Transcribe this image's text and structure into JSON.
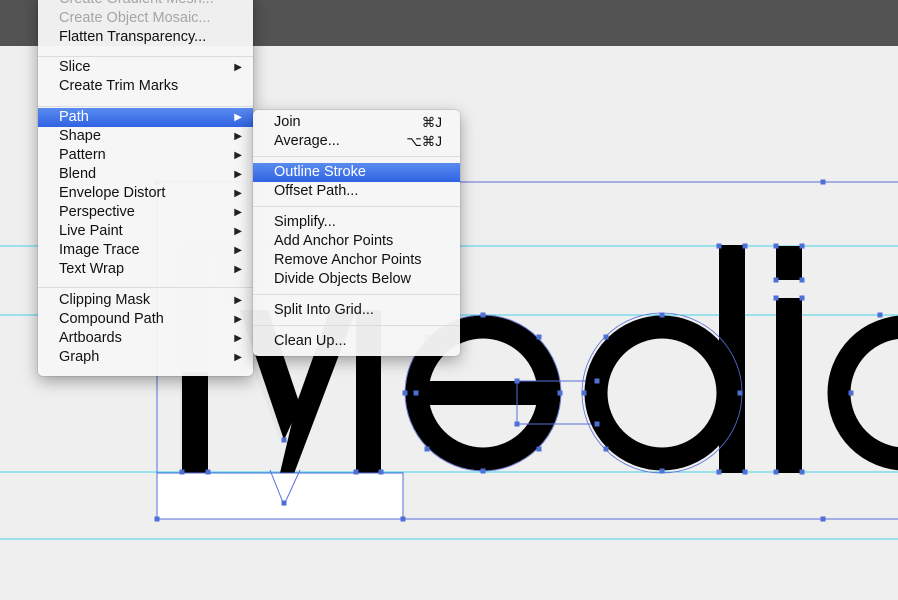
{
  "main_menu": {
    "items": [
      {
        "label": "Create Gradient Mesh...",
        "disabled": true,
        "submenu": false
      },
      {
        "label": "Create Object Mosaic...",
        "disabled": true,
        "submenu": false
      },
      {
        "label": "Flatten Transparency...",
        "disabled": false,
        "submenu": false
      },
      {
        "label": "Slice",
        "disabled": false,
        "submenu": true
      },
      {
        "label": "Create Trim Marks",
        "disabled": false,
        "submenu": false
      },
      {
        "label": "Path",
        "disabled": false,
        "submenu": true,
        "highlighted": true
      },
      {
        "label": "Shape",
        "disabled": false,
        "submenu": true
      },
      {
        "label": "Pattern",
        "disabled": false,
        "submenu": true
      },
      {
        "label": "Blend",
        "disabled": false,
        "submenu": true
      },
      {
        "label": "Envelope Distort",
        "disabled": false,
        "submenu": true
      },
      {
        "label": "Perspective",
        "disabled": false,
        "submenu": true
      },
      {
        "label": "Live Paint",
        "disabled": false,
        "submenu": true
      },
      {
        "label": "Image Trace",
        "disabled": false,
        "submenu": true
      },
      {
        "label": "Text Wrap",
        "disabled": false,
        "submenu": true
      },
      {
        "label": "Clipping Mask",
        "disabled": false,
        "submenu": true
      },
      {
        "label": "Compound Path",
        "disabled": false,
        "submenu": true
      },
      {
        "label": "Artboards",
        "disabled": false,
        "submenu": true
      },
      {
        "label": "Graph",
        "disabled": false,
        "submenu": true
      }
    ],
    "submenu_arrow": "▶"
  },
  "path_submenu": {
    "items": [
      {
        "label": "Join",
        "shortcut": "⌘J"
      },
      {
        "label": "Average...",
        "shortcut": "⌥⌘J"
      },
      {
        "label": "Outline Stroke",
        "shortcut": "",
        "highlighted": true
      },
      {
        "label": "Offset Path...",
        "shortcut": ""
      },
      {
        "label": "Simplify...",
        "shortcut": ""
      },
      {
        "label": "Add Anchor Points",
        "shortcut": ""
      },
      {
        "label": "Remove Anchor Points",
        "shortcut": ""
      },
      {
        "label": "Divide Objects Below",
        "shortcut": ""
      },
      {
        "label": "Split Into Grid...",
        "shortcut": ""
      },
      {
        "label": "Clean Up...",
        "shortcut": ""
      }
    ]
  },
  "canvas": {
    "artwork_text": "Media",
    "colors": {
      "background": "#efefef",
      "topbar": "#535353",
      "guide": "#45d3ea",
      "selection": "#4d6fd6",
      "artwork": "#000000",
      "highlight": "#2f63e3"
    }
  }
}
